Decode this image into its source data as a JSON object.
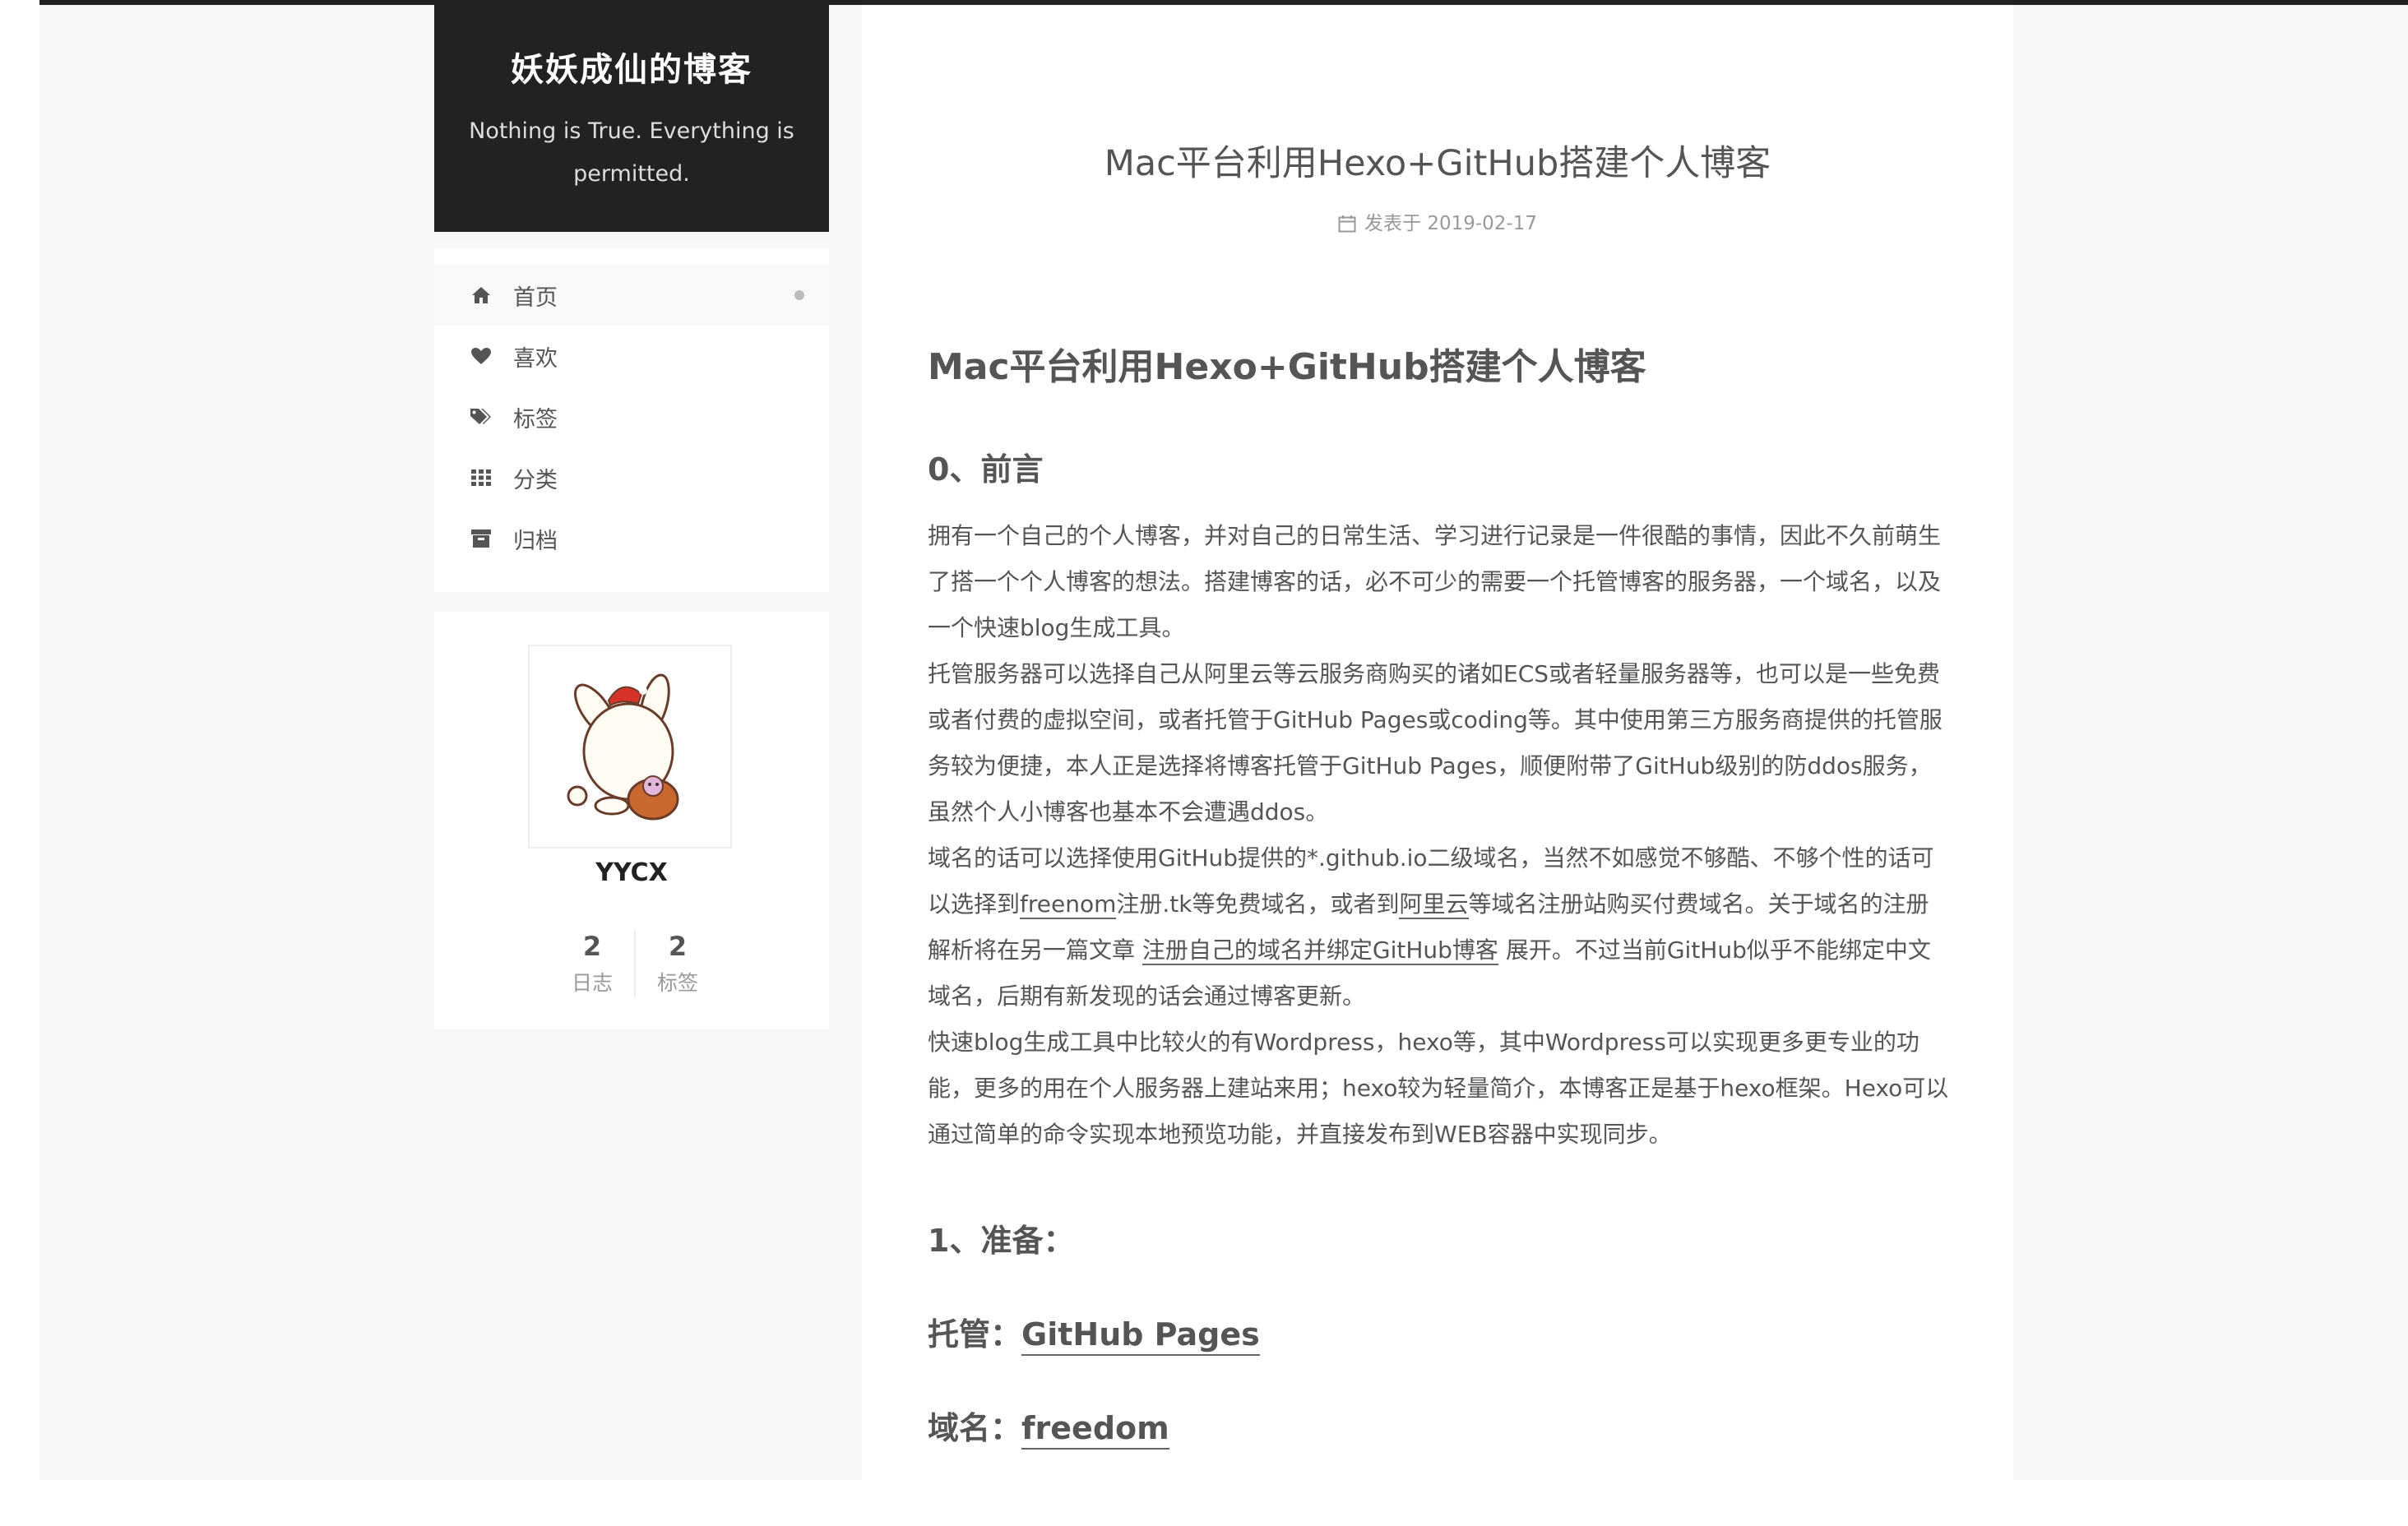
{
  "site": {
    "title": "妖妖成仙的博客",
    "subtitle": "Nothing is True. Everything is permitted."
  },
  "menu": {
    "items": [
      {
        "label": "首页",
        "icon": "home-icon"
      },
      {
        "label": "喜欢",
        "icon": "heart-icon"
      },
      {
        "label": "标签",
        "icon": "tags-icon"
      },
      {
        "label": "分类",
        "icon": "th-icon"
      },
      {
        "label": "归档",
        "icon": "archive-icon"
      }
    ]
  },
  "author": {
    "name": "YYCX",
    "stats": [
      {
        "count": "2",
        "label": "日志"
      },
      {
        "count": "2",
        "label": "标签"
      }
    ]
  },
  "post": {
    "title": "Mac平台利用Hexo+GitHub搭建个人博客",
    "meta_prefix": "发表于",
    "date": "2019-02-17",
    "h1": "Mac平台利用Hexo+GitHub搭建个人博客",
    "section0": "0、前言",
    "p1": "拥有一个自己的个人博客，并对自己的日常生活、学习进行记录是一件很酷的事情，因此不久前萌生了搭一个个人博客的想法。搭建博客的话，必不可少的需要一个托管博客的服务器，一个域名，以及一个快速blog生成工具。",
    "p2": "托管服务器可以选择自己从阿里云等云服务商购买的诸如ECS或者轻量服务器等，也可以是一些免费或者付费的虚拟空间，或者托管于GitHub Pages或coding等。其中使用第三方服务商提供的托管服务较为便捷，本人正是选择将博客托管于GitHub Pages，顺便附带了GitHub级别的防ddos服务，虽然个人小博客也基本不会遭遇ddos。",
    "p3": {
      "part1": "域名的话可以选择使用GitHub提供的*.github.io二级域名，当然不如感觉不够酷、不够个性的话可以选择到",
      "link1": "freenom",
      "part2": "注册.tk等免费域名，或者到",
      "link2": "阿里云",
      "part3": "等域名注册站购买付费域名。关于域名的注册解析将在另一篇文章 ",
      "link3": "注册自己的域名并绑定GitHub博客",
      "part4": " 展开。不过当前GitHub似乎不能绑定中文域名，后期有新发现的话会通过博客更新。"
    },
    "p4": "快速blog生成工具中比较火的有Wordpress，hexo等，其中Wordpress可以实现更多更专业的功能，更多的用在个人服务器上建站来用；hexo较为轻量简介，本博客正是基于hexo框架。Hexo可以通过简单的命令实现本地预览功能，并直接发布到WEB容器中实现同步。",
    "section1": "1、准备：",
    "hosting_label": "托管：",
    "hosting_link": "GitHub Pages",
    "domain_label": "域名：",
    "domain_link": "freedom"
  },
  "colors": {
    "brand_bg": "#222222",
    "page_bg": "#f5f7f9",
    "text": "#555555",
    "muted": "#999999"
  }
}
